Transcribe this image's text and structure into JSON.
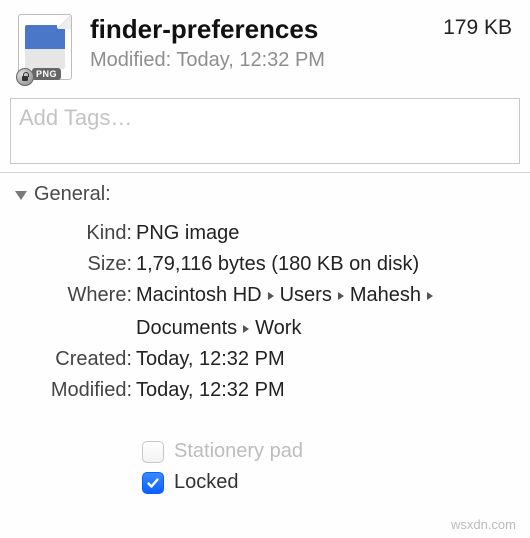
{
  "header": {
    "title": "finder-preferences",
    "modified_line": "Modified: Today, 12:32 PM",
    "size": "179 KB",
    "icon_badge": "PNG"
  },
  "tags": {
    "placeholder": "Add Tags…"
  },
  "section": {
    "title": "General:"
  },
  "general": {
    "kind_label": "Kind:",
    "kind_value": "PNG image",
    "size_label": "Size:",
    "size_value": "1,79,116 bytes (180 KB on disk)",
    "where_label": "Where:",
    "where_path": [
      "Macintosh HD",
      "Users",
      "Mahesh",
      "Documents",
      "Work"
    ],
    "created_label": "Created:",
    "created_value": "Today, 12:32 PM",
    "modified_label": "Modified:",
    "modified_value": "Today, 12:32 PM",
    "stationery_label": "Stationery pad",
    "stationery_checked": false,
    "locked_label": "Locked",
    "locked_checked": true
  },
  "watermark": "wsxdn.com"
}
